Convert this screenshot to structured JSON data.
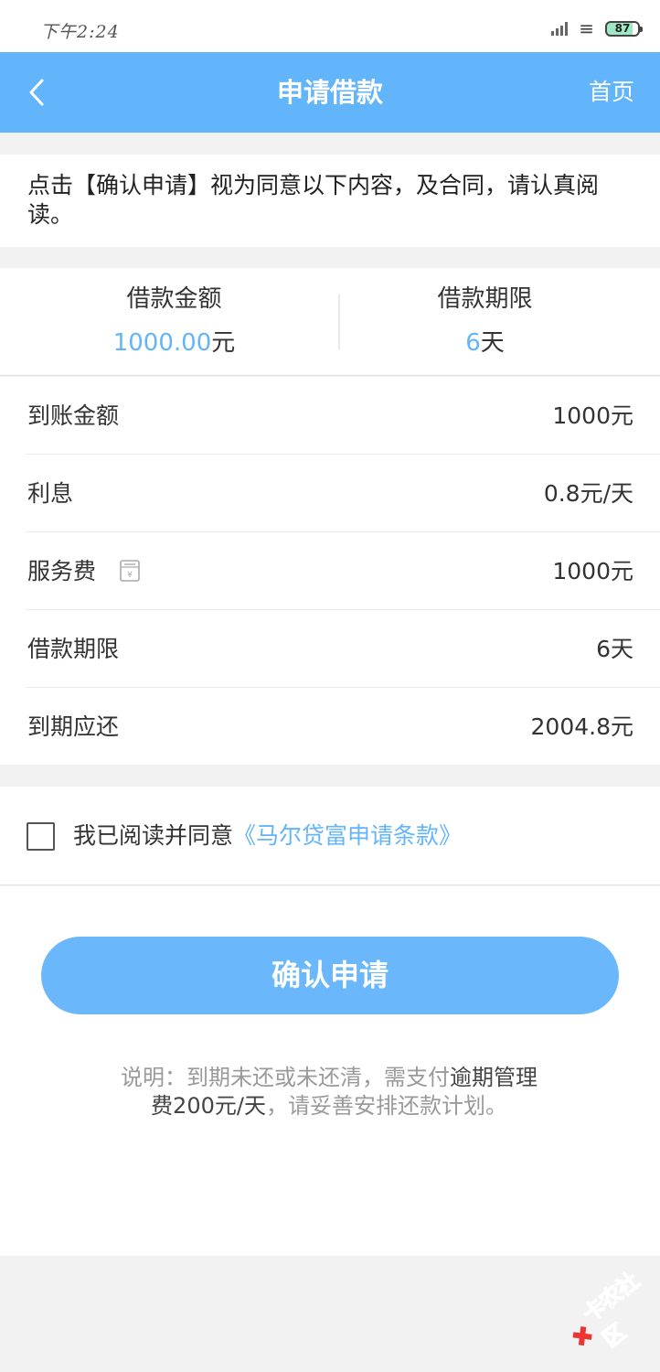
{
  "status": {
    "time": "下午2:24",
    "battery": "87"
  },
  "navbar": {
    "title": "申请借款",
    "home": "首页"
  },
  "notice": {
    "text": "点击【确认申请】视为同意以下内容，及合同，请认真阅读。"
  },
  "summary": {
    "amount_label": "借款金额",
    "amount_value": "1000.00",
    "amount_unit": "元",
    "term_label": "借款期限",
    "term_value": "6",
    "term_unit": "天"
  },
  "details": [
    {
      "label": "到账金额",
      "value": "1000元"
    },
    {
      "label": "利息",
      "value": "0.8元/天"
    },
    {
      "label": "服务费",
      "value": "1000元"
    },
    {
      "label": "借款期限",
      "value": "6天"
    },
    {
      "label": "到期应还",
      "value": "2004.8元"
    }
  ],
  "agreement": {
    "prefix": "我已阅读并同意",
    "link": "《马尔贷富申请条款》",
    "checked": false
  },
  "confirm_label": "确认申请",
  "note": {
    "part1": "说明：到期未还或未还清，需支付",
    "part2": "逾期管理费200元/天",
    "part3": "，请妥善安排还款计划。"
  },
  "watermark": "卡农社区",
  "colors": {
    "accent": "#63b5fb",
    "button": "#6ab8fb"
  }
}
